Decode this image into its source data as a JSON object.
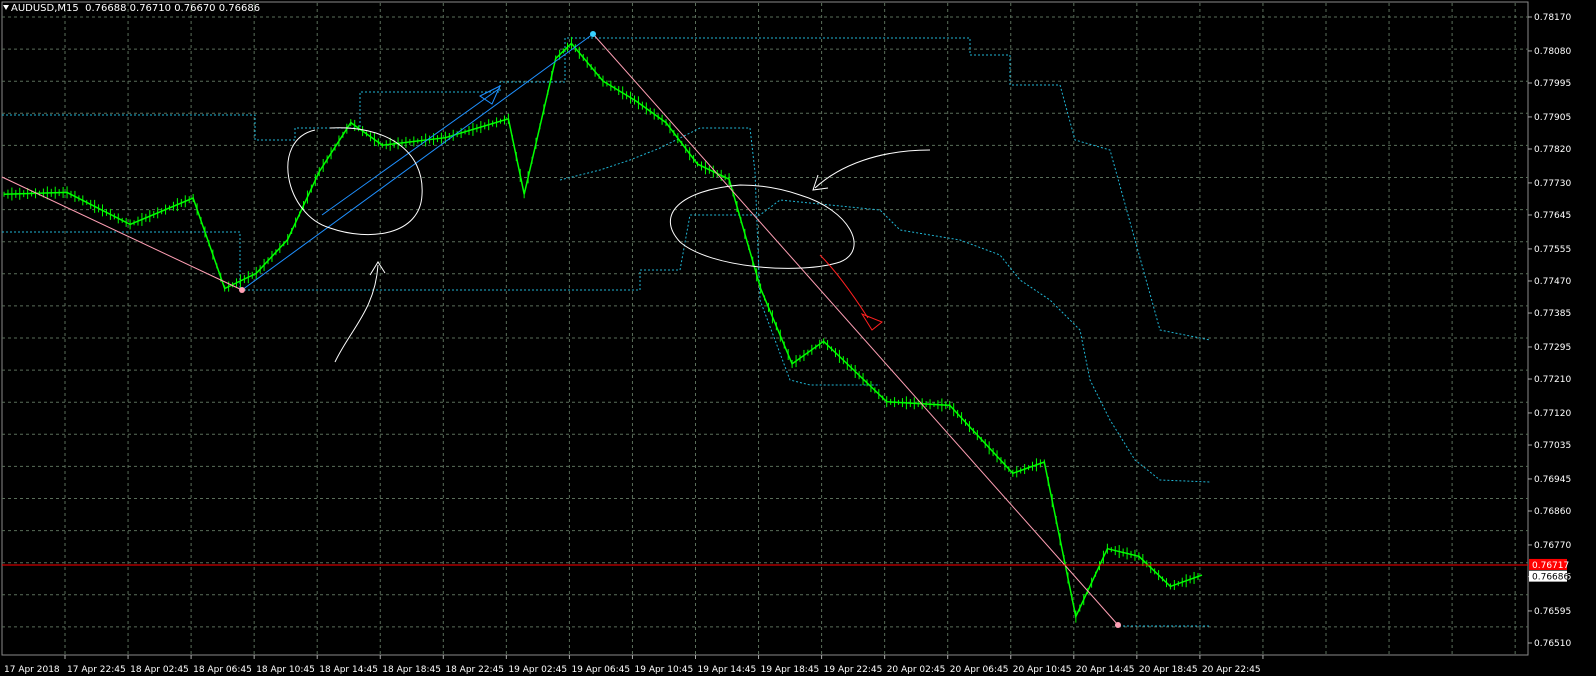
{
  "header": {
    "symbol_tf": "AUDUSD,M15",
    "ohlc": "0.76688 0.76710 0.76670 0.76686"
  },
  "colors": {
    "background": "#000000",
    "grid": "#5a6e5a",
    "candles": "#00ff00",
    "channel": "#1fb5d4",
    "trend_up": "#1e90ff",
    "trend_down": "#ff9fb4",
    "ask_line": "#ff0000",
    "annotation": "#ffffff",
    "arrow_red": "#ff2020"
  },
  "chart_data": {
    "type": "line",
    "title": "AUDUSD,M15",
    "ylim": [
      0.7651,
      0.7817
    ],
    "y_ticks": [
      "0.78170",
      "0.78080",
      "0.77995",
      "0.77905",
      "0.77820",
      "0.77730",
      "0.77645",
      "0.77555",
      "0.77470",
      "0.77385",
      "0.77295",
      "0.77210",
      "0.77120",
      "0.77035",
      "0.76945",
      "0.76860",
      "0.76770",
      "0.76686",
      "0.76595",
      "0.76510"
    ],
    "x_ticks": [
      "17 Apr 2018",
      "17 Apr 22:45",
      "18 Apr 02:45",
      "18 Apr 06:45",
      "18 Apr 10:45",
      "18 Apr 14:45",
      "18 Apr 18:45",
      "18 Apr 22:45",
      "19 Apr 02:45",
      "19 Apr 06:45",
      "19 Apr 10:45",
      "19 Apr 14:45",
      "19 Apr 18:45",
      "19 Apr 22:45",
      "20 Apr 02:45",
      "20 Apr 06:45",
      "20 Apr 10:45",
      "20 Apr 14:45",
      "20 Apr 18:45",
      "20 Apr 22:45"
    ],
    "price_labels": {
      "ask": "0.76717",
      "bid": "0.76686"
    },
    "grid": true,
    "series": [
      {
        "values": [
          {
            "x": "17 Apr 2018",
            "y": 0.777
          },
          {
            "x": "17 Apr 22:45",
            "y": 0.77705
          },
          {
            "x": "18 Apr 02:45",
            "y": 0.7762
          },
          {
            "x": "18 Apr 06:45",
            "y": 0.7769
          },
          {
            "x": "18 Apr 08:45",
            "y": 0.7745
          },
          {
            "x": "18 Apr 10:45",
            "y": 0.7749
          },
          {
            "x": "18 Apr 12:45",
            "y": 0.7758
          },
          {
            "x": "18 Apr 14:45",
            "y": 0.7776
          },
          {
            "x": "18 Apr 16:45",
            "y": 0.7789
          },
          {
            "x": "18 Apr 18:45",
            "y": 0.7783
          },
          {
            "x": "18 Apr 22:45",
            "y": 0.7785
          },
          {
            "x": "19 Apr 02:45",
            "y": 0.779
          },
          {
            "x": "19 Apr 03:45",
            "y": 0.777
          },
          {
            "x": "19 Apr 05:45",
            "y": 0.7806
          },
          {
            "x": "19 Apr 06:45",
            "y": 0.781
          },
          {
            "x": "19 Apr 08:45",
            "y": 0.78
          },
          {
            "x": "19 Apr 10:45",
            "y": 0.7795
          },
          {
            "x": "19 Apr 12:45",
            "y": 0.7789
          },
          {
            "x": "19 Apr 14:45",
            "y": 0.7778
          },
          {
            "x": "19 Apr 16:45",
            "y": 0.7774
          },
          {
            "x": "19 Apr 18:45",
            "y": 0.7745
          },
          {
            "x": "19 Apr 20:45",
            "y": 0.7725
          },
          {
            "x": "19 Apr 22:45",
            "y": 0.7731
          },
          {
            "x": "20 Apr 00:45",
            "y": 0.7723
          },
          {
            "x": "20 Apr 02:45",
            "y": 0.7715
          },
          {
            "x": "20 Apr 06:45",
            "y": 0.7714
          },
          {
            "x": "20 Apr 10:45",
            "y": 0.7696
          },
          {
            "x": "20 Apr 12:45",
            "y": 0.7699
          },
          {
            "x": "20 Apr 14:45",
            "y": 0.7658
          },
          {
            "x": "20 Apr 16:45",
            "y": 0.7676
          },
          {
            "x": "20 Apr 18:45",
            "y": 0.7674
          },
          {
            "x": "20 Apr 20:45",
            "y": 0.7666
          },
          {
            "x": "20 Apr 22:45",
            "y": 0.7669
          }
        ]
      }
    ]
  }
}
